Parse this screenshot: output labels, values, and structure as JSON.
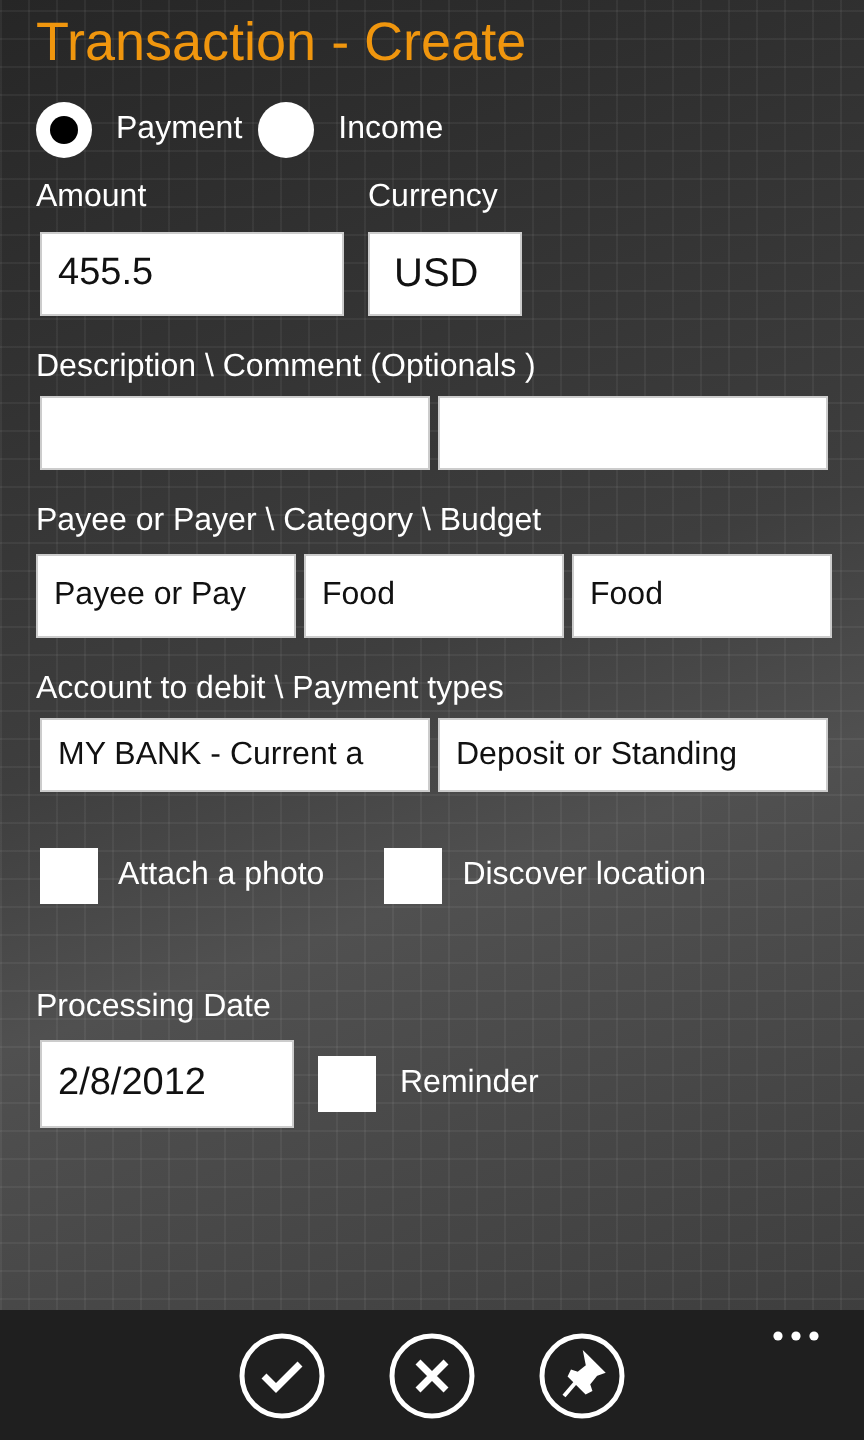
{
  "title": "Transaction - Create",
  "transaction_type": [
    {
      "label": "Payment",
      "selected": true
    },
    {
      "label": "Income",
      "selected": false
    }
  ],
  "amount": {
    "label": "Amount",
    "value": "455.5"
  },
  "currency": {
    "label": "Currency",
    "value": "USD"
  },
  "description": {
    "label": "Description \\ Comment (Optionals )",
    "fields": [
      {
        "kind": "text"
      },
      {
        "kind": "text"
      }
    ]
  },
  "payee_category_budget": {
    "label": "Payee or Payer \\ Category \\ Budget",
    "fields": [
      {
        "value": "Payee or Pay"
      },
      {
        "value": "Food"
      },
      {
        "value": "Food"
      }
    ]
  },
  "account_payment": {
    "label": "Account to debit \\ Payment types",
    "fields": [
      {
        "value": "MY BANK - Current a"
      },
      {
        "value": "Deposit or Standing"
      }
    ]
  },
  "options": [
    {
      "label": "Attach a photo",
      "checked": false
    },
    {
      "label": "Discover location",
      "checked": false
    }
  ],
  "processing_date": {
    "label": "Processing Date",
    "value": "2/8/2012"
  },
  "reminder": {
    "label": "Reminder",
    "checked": false
  },
  "app_bar": {
    "buttons": [
      {
        "kind": "check"
      },
      {
        "kind": "close"
      },
      {
        "kind": "pin"
      }
    ]
  }
}
